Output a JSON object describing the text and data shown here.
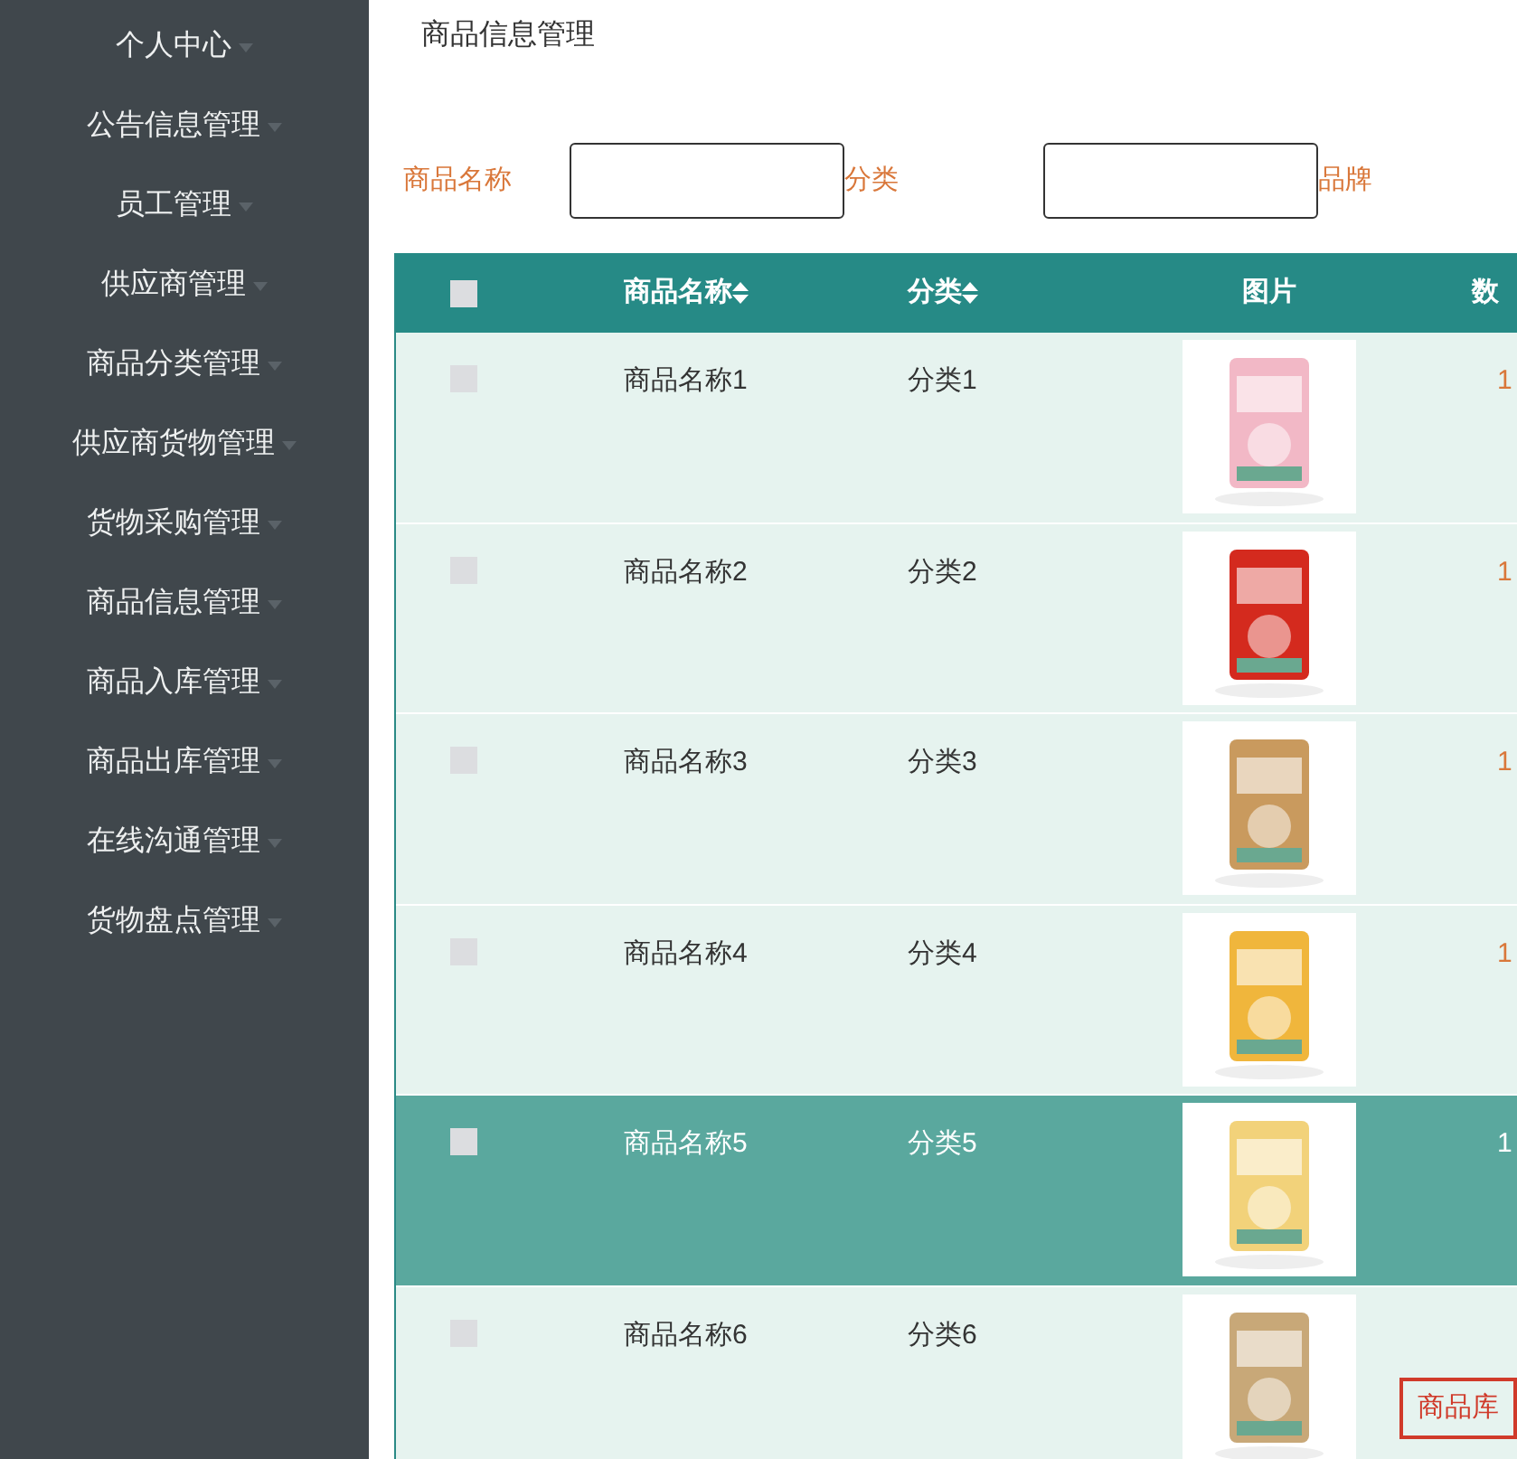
{
  "sidebar": {
    "items": [
      {
        "label": "个人中心"
      },
      {
        "label": "公告信息管理"
      },
      {
        "label": "员工管理"
      },
      {
        "label": "供应商管理"
      },
      {
        "label": "商品分类管理"
      },
      {
        "label": "供应商货物管理"
      },
      {
        "label": "货物采购管理"
      },
      {
        "label": "商品信息管理"
      },
      {
        "label": "商品入库管理"
      },
      {
        "label": "商品出库管理"
      },
      {
        "label": "在线沟通管理"
      },
      {
        "label": "货物盘点管理"
      }
    ]
  },
  "page_title": "商品信息管理",
  "search": {
    "fields": [
      {
        "label": "商品名称"
      },
      {
        "label": "分类"
      },
      {
        "label": "品牌"
      }
    ]
  },
  "table": {
    "select_all_checked": false,
    "columns": [
      {
        "label": "商品名称",
        "sortable": true
      },
      {
        "label": "分类",
        "sortable": true
      },
      {
        "label": "图片",
        "sortable": false
      },
      {
        "label": "数",
        "sortable": false
      }
    ],
    "rows": [
      {
        "name": "商品名称1",
        "category": "分类1",
        "column_5": "1",
        "highlighted": false,
        "checked": false
      },
      {
        "name": "商品名称2",
        "category": "分类2",
        "column_5": "1",
        "highlighted": false,
        "checked": false
      },
      {
        "name": "商品名称3",
        "category": "分类3",
        "column_5": "1",
        "highlighted": false,
        "checked": false
      },
      {
        "name": "商品名称4",
        "category": "分类4",
        "column_5": "1",
        "highlighted": false,
        "checked": false
      },
      {
        "name": "商品名称5",
        "category": "分类5",
        "column_5": "1",
        "highlighted": true,
        "checked": false
      },
      {
        "name": "商品名称6",
        "category": "分类6",
        "highlighted": false,
        "checked": false
      }
    ]
  },
  "bottom_button": "商品库"
}
